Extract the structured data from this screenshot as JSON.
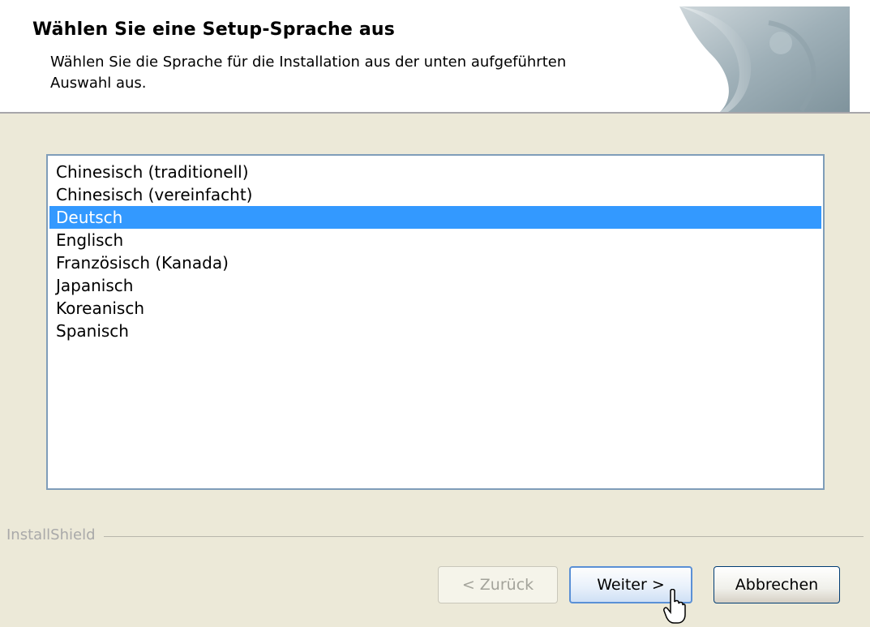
{
  "header": {
    "title": "Wählen Sie eine Setup-Sprache aus",
    "subtitle": "Wählen Sie die Sprache für die Installation aus der unten aufgeführten Auswahl aus."
  },
  "language_list": {
    "items": [
      "Chinesisch (traditionell)",
      "Chinesisch (vereinfacht)",
      "Deutsch",
      "Englisch",
      "Französisch (Kanada)",
      "Japanisch",
      "Koreanisch",
      "Spanisch"
    ],
    "selected": "Deutsch",
    "selected_color": "#3399ff"
  },
  "branding": {
    "label": "InstallShield"
  },
  "buttons": {
    "back": "< Zurück",
    "next": "Weiter >",
    "cancel": "Abbrechen"
  },
  "icons": {
    "header_graphic": "page-curl-graphic",
    "cursor": "mouse-pointer-icon"
  }
}
